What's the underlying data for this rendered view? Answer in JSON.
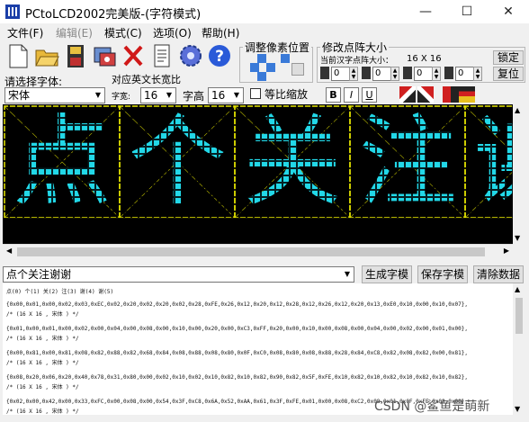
{
  "window": {
    "title": "PCtoLCD2002完美版-(字符模式)",
    "controls": [
      "—",
      "☐",
      "✕"
    ]
  },
  "menu": [
    {
      "label": "文件(F)",
      "enabled": true
    },
    {
      "label": "编辑(E)",
      "enabled": false
    },
    {
      "label": "模式(C)",
      "enabled": true
    },
    {
      "label": "选项(O)",
      "enabled": true
    },
    {
      "label": "帮助(H)",
      "enabled": true
    }
  ],
  "toolbar_icons": [
    "new-file-icon",
    "open-folder-icon",
    "save-icon",
    "import-image-icon",
    "delete-icon",
    "notepad-icon",
    "settings-gear-icon",
    "help-icon"
  ],
  "pixel_adjust": {
    "label": "调整像素位置"
  },
  "resize": {
    "label": "修改点阵大小",
    "current_label": "当前汉字点阵大小：",
    "current_size": "16 X 16",
    "spins": [
      "0",
      "0",
      "0",
      "0",
      "0"
    ],
    "lock_label": "锁定",
    "reset_label": "复位"
  },
  "font": {
    "select_label": "请选择字体:",
    "font_name": "宋体",
    "width_ratio_label": "对应英文长宽比",
    "width_label": "字宽:",
    "width_value": "16",
    "height_label": "字高",
    "height_value": "16",
    "proportional_label": "等比缩放",
    "bold": "B",
    "italic": "I",
    "underline": "U"
  },
  "glyphs": [
    "点",
    "个",
    "关",
    "注",
    "谢"
  ],
  "glyph_colors": {
    "background": "#000000",
    "pixel": "#22d8e8",
    "grid": "#e8e800"
  },
  "input": {
    "text": "点个关注谢谢"
  },
  "buttons": {
    "generate": "生成字模",
    "save": "保存字模",
    "clear": "清除数据"
  },
  "output": {
    "header": "点(0) 个(1) 关(2) 注(3) 谢(4) 谢(5)",
    "lines": [
      "{0x00,0x01,0x00,0x02,0x03,0xEC,0x02,0x20,0x02,0x20,0x02,0x28,0xFE,0x26,0x12,0x20,0x12,0x28,0x12,0x26,0x12,0x20,0x13,0xE0,0x10,0x00,0x10,0x07},",
      "/* (16 X 16 , 宋体 ) */",
      "",
      "{0x01,0x00,0x01,0x00,0x02,0x00,0x04,0x00,0x08,0x00,0x10,0x00,0x20,0x00,0xC3,0xFF,0x20,0x00,0x10,0x00,0x08,0x00,0x04,0x00,0x02,0x00,0x01,0x00},",
      "/* (16 X 16 , 宋体 ) */",
      "",
      "{0x00,0x81,0x00,0x81,0x08,0x82,0x88,0x82,0x68,0x84,0x08,0x88,0x08,0x80,0x0F,0xC0,0x08,0x80,0x08,0x88,0x28,0x84,0xC8,0x82,0x08,0x82,0x00,0x81},",
      "/* (16 X 16 , 宋体 ) */",
      "",
      "{0x08,0x20,0x06,0x20,0x40,0x78,0x31,0x80,0x00,0x02,0x10,0x02,0x10,0x82,0x10,0x82,0x90,0x82,0x5F,0xFE,0x10,0x82,0x10,0x82,0x10,0x82,0x10,0x82},",
      "/* (16 X 16 , 宋体 ) */",
      "",
      "{0x02,0x00,0x42,0x00,0x33,0xFC,0x00,0x08,0x00,0x54,0x3F,0xC8,0x6A,0x52,0xAA,0x61,0x3F,0xFE,0x01,0x00,0x08,0xC2,0x08,0x01,0x0F,0xFE,0x08,0x00},",
      "/* (16 X 16 , 宋体 ) */"
    ]
  },
  "watermark": "CSDN @鲨鱼是萌新"
}
